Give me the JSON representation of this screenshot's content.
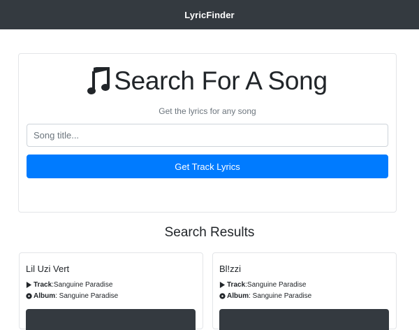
{
  "navbar": {
    "brand": "LyricFinder"
  },
  "search": {
    "title": "Search For A Song",
    "subtitle": "Get the lyrics for any song",
    "input_placeholder": "Song title...",
    "input_value": "",
    "button_label": "Get Track Lyrics",
    "icon": "music-note-icon"
  },
  "results": {
    "heading": "Search Results",
    "items": [
      {
        "artist": "Lil Uzi Vert",
        "track_label": "Track",
        "track": ":Sanguine Paradise",
        "album_label": "Album",
        "album": ": Sanguine Paradise"
      },
      {
        "artist": "Bl!zzi",
        "track_label": "Track",
        "track": ":Sanguine Paradise",
        "album_label": "Album",
        "album": ": Sanguine Paradise"
      }
    ]
  },
  "colors": {
    "navbar": "#343a40",
    "primary": "#007bff",
    "dark_button": "#343a40"
  }
}
